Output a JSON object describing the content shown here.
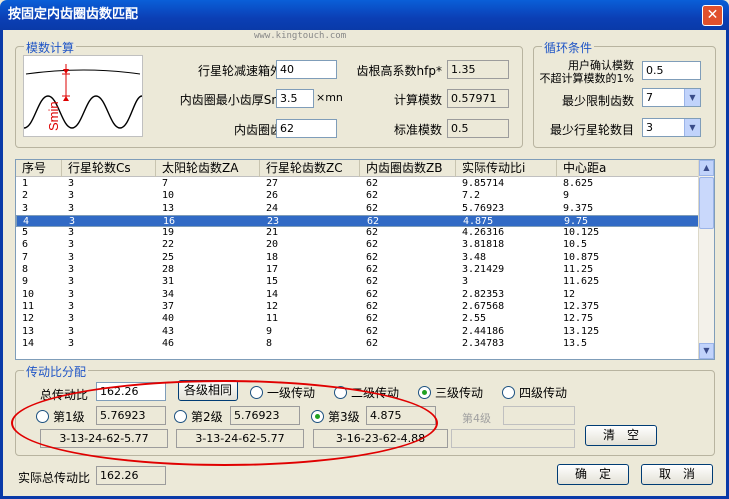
{
  "window": {
    "title": "按固定内齿圈齿数匹配",
    "watermark": "www.kingtouch.com"
  },
  "module": {
    "title": "模数计算",
    "diagram_label": "Smin",
    "fields": [
      {
        "label": "行星轮减速箱外径",
        "value": "40"
      },
      {
        "label": "内齿圈最小齿厚Smin",
        "value": "3.5",
        "unit": "×mn"
      },
      {
        "label": "内齿圈齿数",
        "value": "62"
      }
    ],
    "readouts": [
      {
        "label": "齿根高系数hfp*",
        "value": "1.35"
      },
      {
        "label": "计算模数",
        "value": "0.57971"
      },
      {
        "label": "标准模数",
        "value": "0.5"
      }
    ]
  },
  "loop": {
    "title": "循环条件",
    "confirm_label_1": "用户确认模数",
    "confirm_label_2": "不超计算模数的1%",
    "confirm_value": "0.5",
    "min_teeth_label": "最少限制齿数",
    "min_teeth_value": "7",
    "min_planets_label": "最少行星轮数目",
    "min_planets_value": "3"
  },
  "table": {
    "columns": [
      "序号",
      "行星轮数Cs",
      "太阳轮齿数ZA",
      "行星轮齿数ZC",
      "内齿圈齿数ZB",
      "实际传动比i",
      "中心距a"
    ],
    "selected_index": 3,
    "rows": [
      [
        "1",
        "3",
        "7",
        "27",
        "62",
        "9.85714",
        "8.625"
      ],
      [
        "2",
        "3",
        "10",
        "26",
        "62",
        "7.2",
        "9"
      ],
      [
        "3",
        "3",
        "13",
        "24",
        "62",
        "5.76923",
        "9.375"
      ],
      [
        "4",
        "3",
        "16",
        "23",
        "62",
        "4.875",
        "9.75"
      ],
      [
        "5",
        "3",
        "19",
        "21",
        "62",
        "4.26316",
        "10.125"
      ],
      [
        "6",
        "3",
        "22",
        "20",
        "62",
        "3.81818",
        "10.5"
      ],
      [
        "7",
        "3",
        "25",
        "18",
        "62",
        "3.48",
        "10.875"
      ],
      [
        "8",
        "3",
        "28",
        "17",
        "62",
        "3.21429",
        "11.25"
      ],
      [
        "9",
        "3",
        "31",
        "15",
        "62",
        "3",
        "11.625"
      ],
      [
        "10",
        "3",
        "34",
        "14",
        "62",
        "2.82353",
        "12"
      ],
      [
        "11",
        "3",
        "37",
        "12",
        "62",
        "2.67568",
        "12.375"
      ],
      [
        "12",
        "3",
        "40",
        "11",
        "62",
        "2.55",
        "12.75"
      ],
      [
        "13",
        "3",
        "43",
        "9",
        "62",
        "2.44186",
        "13.125"
      ],
      [
        "14",
        "3",
        "46",
        "8",
        "62",
        "2.34783",
        "13.5"
      ]
    ]
  },
  "ratio": {
    "title": "传动比分配",
    "total_label": "总传动比",
    "total_value": "162.26",
    "same_button": "各级相同",
    "modes": [
      "一级传动",
      "二级传动",
      "三级传动",
      "四级传动"
    ],
    "selected_mode": 2,
    "stages": [
      {
        "label": "第1级",
        "value": "5.76923",
        "combo": "3-13-24-62-5.77"
      },
      {
        "label": "第2级",
        "value": "5.76923",
        "combo": "3-13-24-62-5.77"
      },
      {
        "label": "第3级",
        "value": "4.875",
        "combo": "3-16-23-62-4.88"
      },
      {
        "label": "第4级",
        "value": "",
        "combo": ""
      }
    ],
    "selected_stage": 2,
    "clear_button": "清　空"
  },
  "footer": {
    "actual_label": "实际总传动比",
    "actual_value": "162.26",
    "ok_button": "确　定",
    "cancel_button": "取　消"
  },
  "colors": {
    "title_bar": "#0a3aa8",
    "group_title": "#1f55c6",
    "selection": "#316ac5",
    "highlight_ellipse": "#e00000"
  }
}
